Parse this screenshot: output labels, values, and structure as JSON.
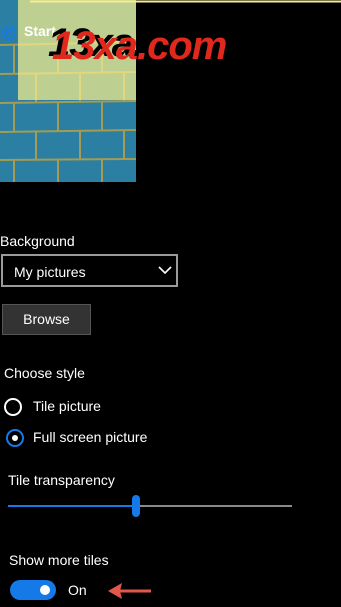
{
  "watermark": "13xa.com",
  "preview": {
    "start_label": "Start",
    "colors": {
      "tile": "#2a7fa2",
      "tile_lines": "#a59b52",
      "overlay": "#f8ee8c"
    }
  },
  "background": {
    "label": "Background",
    "selected": "My pictures",
    "browse_label": "Browse"
  },
  "style": {
    "label": "Choose style",
    "options": [
      {
        "label": "Tile picture",
        "selected": false
      },
      {
        "label": "Full screen picture",
        "selected": true
      }
    ]
  },
  "transparency": {
    "label": "Tile transparency",
    "value_fraction": 0.45
  },
  "show_more_tiles": {
    "label": "Show more tiles",
    "state": "On",
    "on": true
  },
  "colors": {
    "accent": "#1679e8",
    "background": "#000000",
    "annotation_arrow": "#e2574c"
  }
}
